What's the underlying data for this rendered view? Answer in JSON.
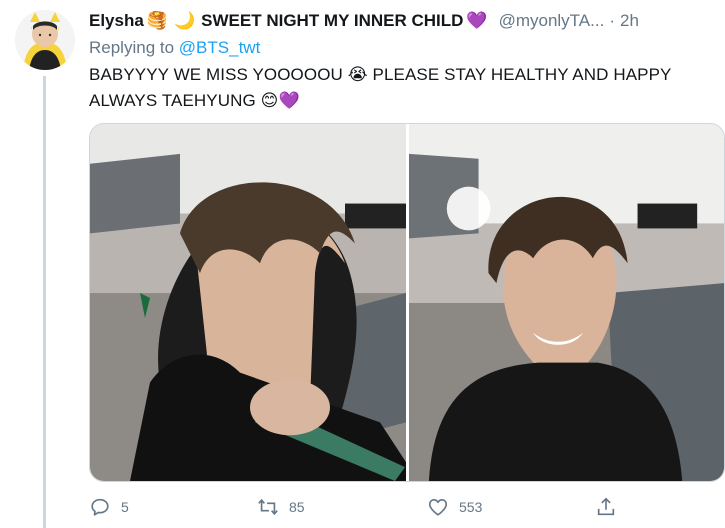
{
  "tweet": {
    "display_name": "Elysha",
    "display_name_suffix": "SWEET NIGHT MY INNER CHILD",
    "name_emojis": [
      "🥞",
      "🌙"
    ],
    "name_heart": "💜",
    "handle": "@myonlyTA...",
    "separator": "·",
    "timestamp": "2h",
    "replying_prefix": "Replying to",
    "replying_to": "@BTS_twt",
    "text": "BABYYYY WE MISS YOOOOOU 😭 PLEASE STAY HEALTHY AND HAPPY ALWAYS TAEHYUNG 😊💜",
    "media_count": 2
  },
  "actions": {
    "reply_count": "5",
    "retweet_count": "85",
    "like_count": "553"
  },
  "icons": {
    "reply": "reply-icon",
    "retweet": "retweet-icon",
    "like": "heart-icon",
    "share": "share-icon",
    "more": "chevron-down-icon"
  },
  "colors": {
    "link": "#1da1f2",
    "secondary_text": "#657786",
    "border": "#ccd6dd"
  }
}
